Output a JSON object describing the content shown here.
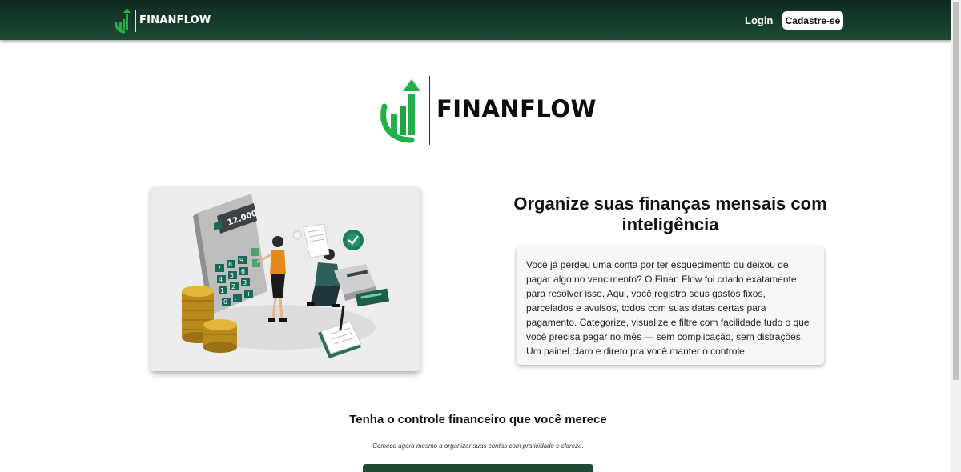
{
  "nav": {
    "brand": "FINANFLOW",
    "login_label": "Login",
    "signup_label": "Cadastre-se"
  },
  "hero": {
    "logo_text": "FINANFLOW"
  },
  "illustration": {
    "calculator_display": "12.000",
    "keypad": [
      "7",
      "8",
      "9",
      "4",
      "5",
      "6",
      "1",
      "2",
      "3",
      "0",
      ".",
      "+"
    ]
  },
  "intro": {
    "headline": "Organize suas finanças mensais com inteligência",
    "description": "Você já perdeu uma conta por ter esquecimento ou deixou de pagar algo no vencimento? O Finan Flow foi criado exatamente para resolver isso. Aqui, você registra seus gastos fixos, parcelados e avulsos, todos com suas datas certas para pagamento. Categorize, visualize e filtre com facilidade tudo o que você precisa pagar no mês — sem complicação, sem distrações. Um painel claro e direto pra você manter o controle."
  },
  "cta": {
    "title": "Tenha o controle financeiro que você merece",
    "subtitle": "Comece agora mesmo a organizar suas contas com praticidade e clareza."
  },
  "colors": {
    "nav_dark": "#0f2a20",
    "nav_green": "#1c4a33",
    "brand_green": "#22b04b",
    "brand_green_dark": "#138a3a"
  }
}
